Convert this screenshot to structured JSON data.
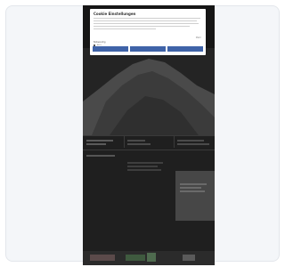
{
  "cookie_modal": {
    "title": "Cookie Einstellungen",
    "more_link": "Mehr",
    "necessary_label": "Notwendig",
    "necessary_toggle_label": "Aktiv",
    "buttons": [
      "",
      "",
      ""
    ]
  },
  "page": {
    "left_heading": "",
    "rows": [
      "",
      "",
      ""
    ]
  },
  "colors": {
    "page_bg": "#1f1f1f",
    "button_blue": "#3f63a8",
    "modal_bg": "#ffffff"
  }
}
